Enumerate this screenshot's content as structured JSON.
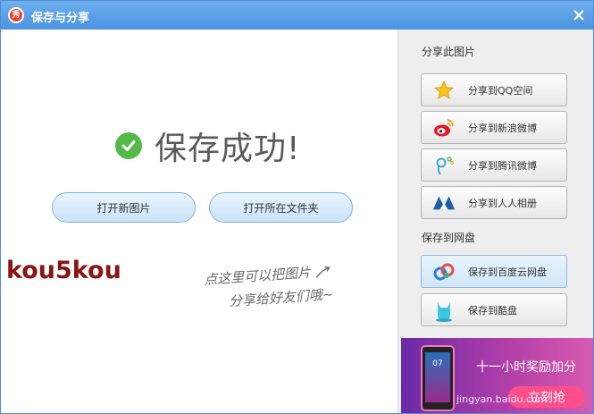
{
  "window": {
    "title": "保存与分享",
    "app_icon_text": "秀",
    "close_icon": "close-icon"
  },
  "main": {
    "success_text": "保存成功!",
    "buttons": {
      "open_new_image": "打开新图片",
      "open_folder": "打开所在文件夹"
    },
    "watermark_text": "kou5kou",
    "hint_line1": "点这里可以把图片",
    "hint_line2": "分享给好友们哦~"
  },
  "sidebar": {
    "share_section_label": "分享此图片",
    "share_buttons": [
      {
        "label": "分享到QQ空间",
        "icon": "qzone-star-icon"
      },
      {
        "label": "分享到新浪微博",
        "icon": "weibo-icon"
      },
      {
        "label": "分享到腾讯微博",
        "icon": "tencent-weibo-icon"
      },
      {
        "label": "分享到人人相册",
        "icon": "renren-icon"
      }
    ],
    "cloud_section_label": "保存到网盘",
    "cloud_buttons": [
      {
        "label": "保存到百度云网盘",
        "icon": "baidu-cloud-icon",
        "active": true
      },
      {
        "label": "保存到酷盘",
        "icon": "kupan-icon",
        "active": false
      }
    ]
  },
  "ad": {
    "phone_screen_text": "07",
    "headline": "十一小时奖励加分",
    "button_label": "立刻抢",
    "site_text": "jingyan.baidu.com"
  },
  "colors": {
    "titlebar": "#4a93e0",
    "success_green": "#54b948",
    "watermark_red": "#8b1414",
    "sidebar_bg": "#eeeeee"
  }
}
